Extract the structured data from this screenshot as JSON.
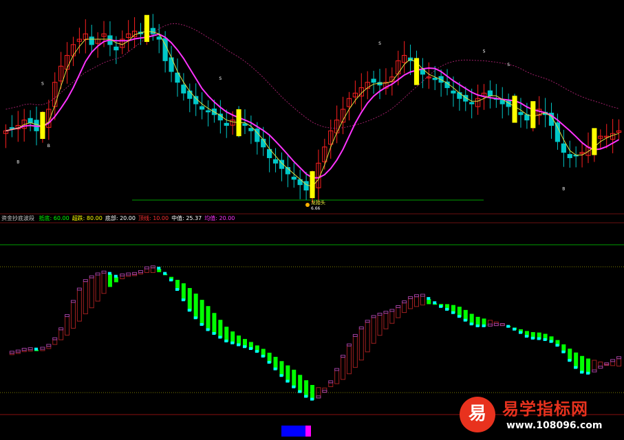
{
  "legend": {
    "indicator_name": "资金抄底波段",
    "items": [
      {
        "label": "抵底:",
        "value": "60.00",
        "color": "#00ff00"
      },
      {
        "label": "超跌:",
        "value": "80.00",
        "color": "#ffff00"
      },
      {
        "label": "底部:",
        "value": "20.00",
        "color": "#ffffff"
      },
      {
        "label": "顶线:",
        "value": "10.00",
        "color": "#ff3030"
      },
      {
        "label": "中值:",
        "value": "25.37",
        "color": "#ffffff"
      },
      {
        "label": "均值:",
        "value": "20.00",
        "color": "#ff33ff"
      }
    ]
  },
  "annotations": {
    "low_label": "龙抬头",
    "low_price": "6.66",
    "sell_marker": "S",
    "buy_marker": "B"
  },
  "watermark": {
    "logo_char": "易",
    "title": "易学指标网",
    "url": "www.108096.com"
  },
  "colors": {
    "up": "#ff2020",
    "down": "#00c8c8",
    "signal": "#ffff00",
    "ma_fast": "#e0e040",
    "ma_slow": "#ff33ff",
    "ma_long": "#a0206a",
    "osc_green": "#00ff00",
    "osc_cyan": "#00ffff",
    "osc_purple": "#a040a0",
    "osc_red": "#a02020"
  },
  "chart_data": {
    "type": "candlestick",
    "note_kline": "Price panel: K-line with moving averages and S/B signal markers",
    "kline_close": [
      7.9,
      7.95,
      8.0,
      8.1,
      8.05,
      7.9,
      8.0,
      8.3,
      8.8,
      9.1,
      9.3,
      9.5,
      9.6,
      9.7,
      9.5,
      9.6,
      9.7,
      9.5,
      9.4,
      9.6,
      9.7,
      9.75,
      9.7,
      9.8,
      9.7,
      9.6,
      9.2,
      9.0,
      8.8,
      8.6,
      8.5,
      8.4,
      8.3,
      8.25,
      8.2,
      8.1,
      8.0,
      8.1,
      8.05,
      8.0,
      7.9,
      7.7,
      7.6,
      7.4,
      7.3,
      7.2,
      7.1,
      7.0,
      6.9,
      6.8,
      6.9,
      7.3,
      7.6,
      7.9,
      8.1,
      8.3,
      8.5,
      8.6,
      8.7,
      8.8,
      8.8,
      8.75,
      8.8,
      8.9,
      9.2,
      9.3,
      9.2,
      9.0,
      8.95,
      8.9,
      8.85,
      8.8,
      8.7,
      8.6,
      8.5,
      8.45,
      8.4,
      8.5,
      8.6,
      8.55,
      8.5,
      8.4,
      8.35,
      8.3,
      8.2,
      8.1,
      8.2,
      8.3,
      8.2,
      8.0,
      7.7,
      7.5,
      7.4,
      7.45,
      7.5,
      7.6,
      7.7,
      7.8,
      7.8,
      7.85,
      7.9
    ]
  }
}
